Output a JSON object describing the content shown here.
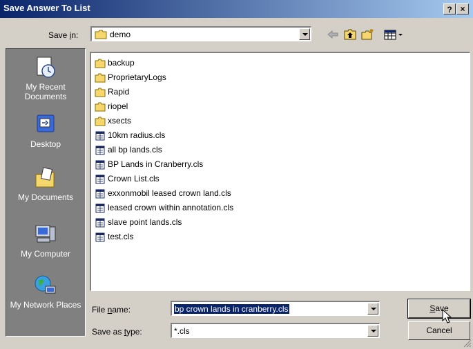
{
  "window": {
    "title": "Save Answer To List",
    "help_label": "?",
    "close_label": "×"
  },
  "toolbar": {
    "save_in_label": "Save in:",
    "save_in_value": "demo"
  },
  "places": [
    {
      "label": "My Recent Documents"
    },
    {
      "label": "Desktop"
    },
    {
      "label": "My Documents"
    },
    {
      "label": "My Computer"
    },
    {
      "label": "My Network Places"
    }
  ],
  "files": [
    {
      "name": "backup",
      "type": "folder"
    },
    {
      "name": "ProprietaryLogs",
      "type": "folder"
    },
    {
      "name": "Rapid",
      "type": "folder"
    },
    {
      "name": "riopel",
      "type": "folder"
    },
    {
      "name": "xsects",
      "type": "folder"
    },
    {
      "name": "10km radius.cls",
      "type": "file"
    },
    {
      "name": "all bp lands.cls",
      "type": "file"
    },
    {
      "name": "BP Lands in Cranberry.cls",
      "type": "file"
    },
    {
      "name": "Crown List.cls",
      "type": "file"
    },
    {
      "name": "exxonmobil leased crown land.cls",
      "type": "file"
    },
    {
      "name": "leased crown within annotation.cls",
      "type": "file"
    },
    {
      "name": "slave point lands.cls",
      "type": "file"
    },
    {
      "name": "test.cls",
      "type": "file"
    }
  ],
  "form": {
    "file_name_label": "File name:",
    "file_name_value": "bp crown lands in cranberry.cls",
    "save_type_label": "Save as type:",
    "save_type_value": "*.cls"
  },
  "buttons": {
    "save": "Save",
    "cancel": "Cancel"
  }
}
